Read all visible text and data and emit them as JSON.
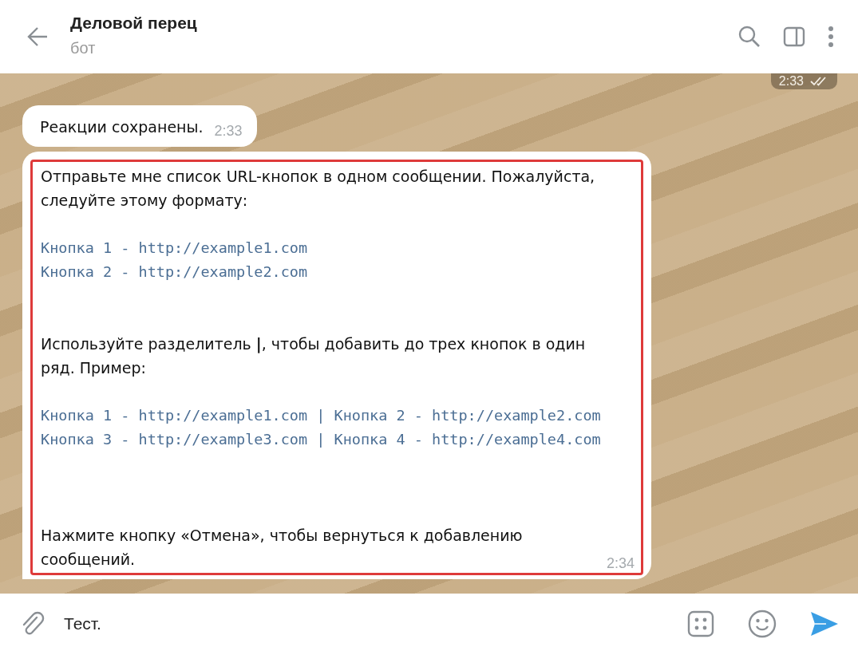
{
  "header": {
    "title": "Деловой перец",
    "subtitle": "бот"
  },
  "messages": [
    {
      "kind": "outgoing",
      "time": "2:33",
      "read": true
    },
    {
      "kind": "incoming",
      "time": "2:33",
      "highlighted": false,
      "blocks": [
        {
          "kind": "text",
          "text": "Реакции сохранены."
        }
      ]
    },
    {
      "kind": "incoming",
      "time": "2:34",
      "highlighted": true,
      "blocks": [
        {
          "kind": "text",
          "text": "Отправьте мне список URL-кнопок в одном сообщении. Пожалуйста, следуйте этому формату:"
        },
        {
          "kind": "code",
          "lines": [
            "Кнопка 1 - http://example1.com",
            "Кнопка 2 - http://example2.com"
          ]
        },
        {
          "kind": "text",
          "text": "Используйте разделитель **|**, чтобы добавить до трех кнопок в один ряд. Пример:"
        },
        {
          "kind": "code",
          "lines": [
            "Кнопка 1 - http://example1.com | Кнопка 2 - http://example2.com",
            "Кнопка 3 - http://example3.com | Кнопка 4 - http://example4.com"
          ]
        },
        {
          "kind": "note",
          "text": "Нажмите кнопку «Отмена», чтобы вернуться к добавлению сообщений."
        }
      ]
    }
  ],
  "composer": {
    "value": "Тест."
  }
}
